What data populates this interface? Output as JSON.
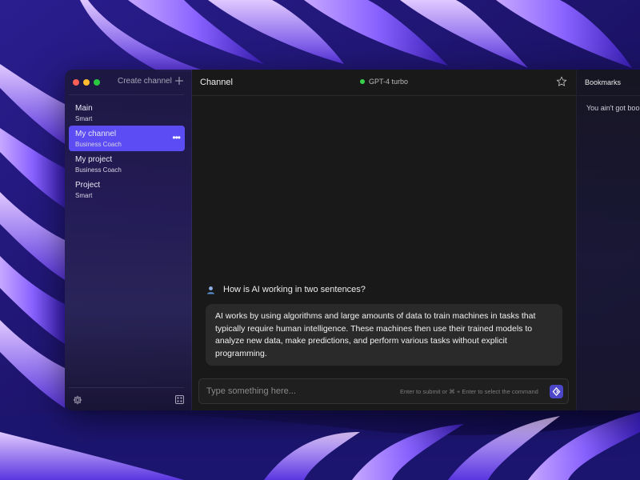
{
  "sidebar": {
    "create_channel_label": "Create channel",
    "channels": [
      {
        "name": "Main",
        "sub": "Smart"
      },
      {
        "name": "My channel",
        "sub": "Business Coach"
      },
      {
        "name": "My project",
        "sub": "Business Coach"
      },
      {
        "name": "Project",
        "sub": "Smart"
      }
    ],
    "active_channel": "My channel"
  },
  "header": {
    "title": "Channel",
    "model": "GPT-4 turbo",
    "status_color": "#3ad14a"
  },
  "chat": {
    "question": "How is AI working in two sentences?",
    "answer": "AI works by using algorithms and large amounts of data to train machines in tasks that typically require human intelligence. These machines then use their trained models to analyze new data, make predictions, and perform various tasks without explicit programming."
  },
  "composer": {
    "placeholder": "Type something here...",
    "hint": "Enter to submit or ⌘ + Enter to select the command"
  },
  "bookmarks": {
    "title": "Bookmarks",
    "empty_text": "You ain't got bookmarks"
  },
  "colors": {
    "accent": "#5b4cf3",
    "main_bg": "#191919",
    "bubble_bg": "#2a2a2a"
  },
  "icons": [
    "plus-icon",
    "more-icon",
    "gear-icon",
    "grid-icon",
    "star-icon",
    "user-icon",
    "send-icon"
  ]
}
